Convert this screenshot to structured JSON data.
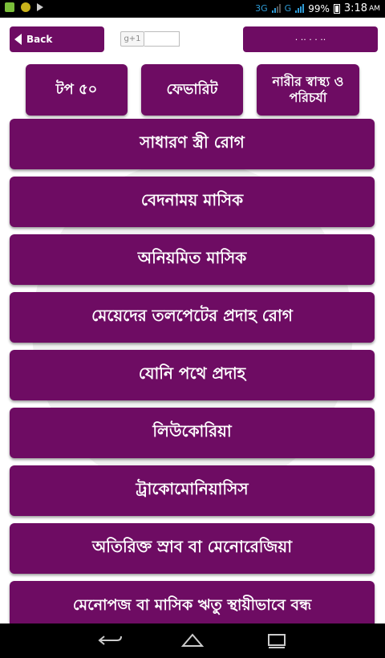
{
  "status_bar": {
    "network_left": "3G",
    "network_right": "G",
    "battery": "99%",
    "time": "3:18",
    "ampm": "AM"
  },
  "header": {
    "back_label": "Back",
    "gplus_label": "g+1",
    "share_label": "· ·· ·  ·  ··"
  },
  "tabs": [
    {
      "label": "টপ ৫০"
    },
    {
      "label": "ফেভারিট"
    },
    {
      "label": "নারীর স্বাস্থ্য ও পরিচর্যা"
    }
  ],
  "menu_items": [
    {
      "label": "সাধারণ স্ত্রী রোগ"
    },
    {
      "label": "বেদনাময় মাসিক"
    },
    {
      "label": "অনিয়মিত মাসিক"
    },
    {
      "label": "মেয়েদের তলপেটের প্রদাহ রোগ"
    },
    {
      "label": "যোনি পথে প্রদাহ"
    },
    {
      "label": "লিউকোরিয়া"
    },
    {
      "label": "ট্রাকোমোনিয়াসিস"
    },
    {
      "label": "অতিরিক্ত স্রাব বা মেনোরেজিয়া"
    },
    {
      "label": "মেনোপজ বা মাসিক ঋতু স্থায়ীভাবে বন্ধ"
    }
  ],
  "colors": {
    "accent": "#6e0c63",
    "status_icon": "#2e9bd6"
  },
  "icons": [
    "back-arrow-icon",
    "gplus-icon",
    "battery-icon",
    "signal-icon",
    "nav-back-icon",
    "nav-home-icon",
    "nav-recent-icon"
  ]
}
